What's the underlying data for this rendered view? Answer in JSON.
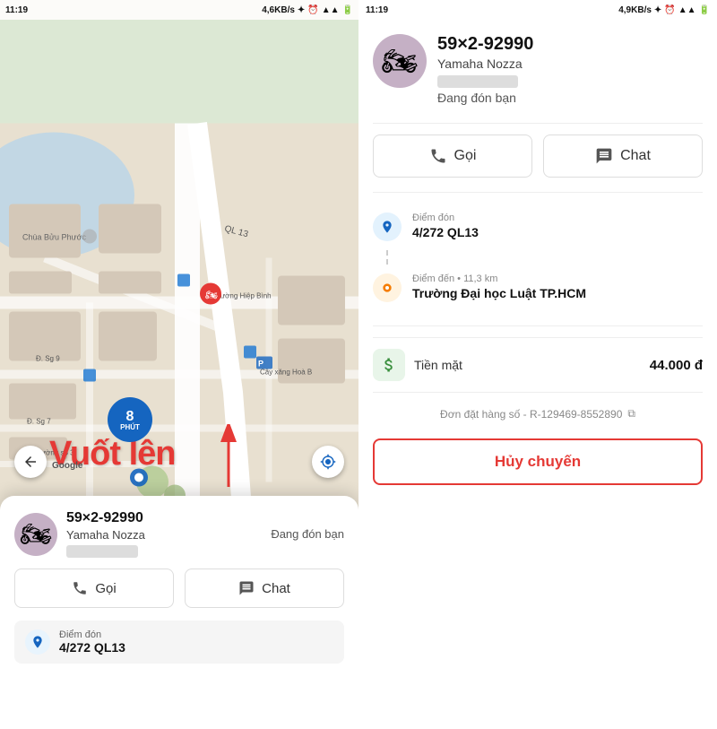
{
  "left": {
    "statusBar": {
      "time": "11:19",
      "speed": "4,6KB/s",
      "battery": "74"
    },
    "map": {
      "overlayText": "Vuốt lên",
      "googleLabel": "Google"
    },
    "minutesBadge": {
      "number": "8",
      "unit": "PHÚT"
    },
    "driver": {
      "plate": "59×2-92990",
      "name": "Yamaha Nozza",
      "status": "Đang đón bạn"
    },
    "actions": {
      "call": "Gọi",
      "chat": "Chat"
    },
    "pickup": {
      "label": "Điểm đón",
      "address": "4/272 QL13"
    }
  },
  "right": {
    "statusBar": {
      "time": "11:19",
      "speed": "4,9KB/s",
      "battery": "74"
    },
    "driver": {
      "plate": "59×2-92990",
      "name": "Yamaha Nozza",
      "status": "Đang đón bạn"
    },
    "actions": {
      "call": "Gọi",
      "chat": "Chat"
    },
    "route": {
      "pickup": {
        "label": "Điểm đón",
        "address": "4/272 QL13"
      },
      "destination": {
        "label": "Điểm đến",
        "distance": "11,3 km",
        "address": "Trường Đại học Luật TP.HCM"
      }
    },
    "payment": {
      "method": "Tiền mặt",
      "amount": "44.000 đ"
    },
    "orderNumber": "Đơn đặt hàng số - R-129469-8552890",
    "cancelBtn": "Hủy chuyến"
  }
}
